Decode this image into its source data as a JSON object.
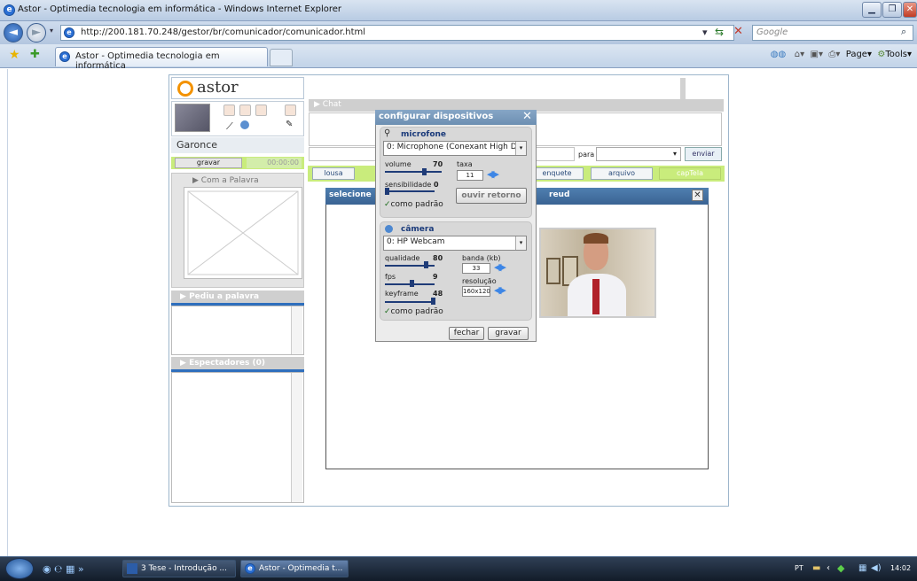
{
  "browser": {
    "window_title": "Astor - Optimedia tecnologia em informática - Windows Internet Explorer",
    "url": "http://200.181.70.248/gestor/br/comunicador/comunicador.html",
    "search_placeholder": "Google",
    "tab_title": "Astor - Optimedia tecnologia em informática",
    "cmd_page": "Page",
    "cmd_tools": "Tools"
  },
  "app": {
    "logo_text": "astor",
    "username": "Garonce",
    "record_button": "gravar",
    "timer": "00:00:00",
    "panel_com_palavra": "Com a Palavra",
    "panel_pediu": "Pediu a palavra",
    "panel_espectadores": "Espectadores  (0)",
    "chat_title": "Chat",
    "para_label": "para",
    "send_button": "enviar",
    "tabs": [
      "lousa",
      "enquete",
      "arquivo",
      "capTela"
    ],
    "whiteboard_title": "selecione",
    "whiteboard_title_right": "reud"
  },
  "dialog": {
    "title": "configurar dispositivos",
    "mic_title": "microfone",
    "mic_device": "0: Microphone (Conexant High D",
    "volume_label": "volume",
    "volume_value": "70",
    "volume_level": 0.7,
    "rate_label": "taxa",
    "rate_value": "11",
    "sensitivity_label": "sensibilidade",
    "sensitivity_value": "0",
    "sensitivity_level": 0,
    "mic_default": "como padrão",
    "monitor_button": "ouvir retorno",
    "camera_title": "câmera",
    "camera_device": "0: HP Webcam",
    "quality_label": "qualidade",
    "quality_value": "80",
    "quality_level": 0.8,
    "bandwidth_label": "banda (kb)",
    "bandwidth_value": "33",
    "fps_label": "fps",
    "fps_value": "9",
    "fps_level": 0.5,
    "resolution_label": "resolução",
    "resolution_value": "160x120",
    "keyframe_label": "keyframe",
    "keyframe_value": "48",
    "keyframe_level": 0.95,
    "camera_default": "como padrão",
    "close_button": "fechar",
    "save_button": "gravar"
  },
  "taskbar": {
    "item1": "3 Tese - Introdução ...",
    "item2": "Astor - Optimedia t...",
    "lang": "PT",
    "clock": "14:02"
  }
}
